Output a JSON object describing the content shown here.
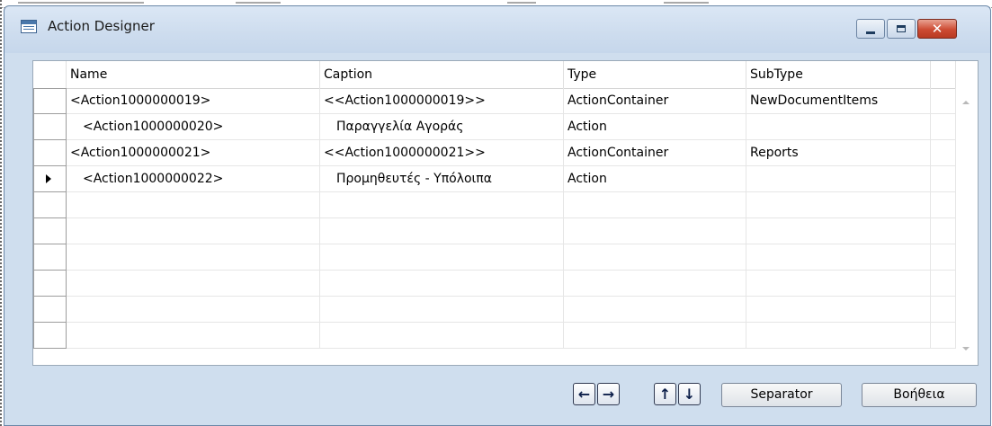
{
  "window": {
    "title": "Action Designer"
  },
  "columns": [
    "Name",
    "Caption",
    "Type",
    "SubType"
  ],
  "rows": [
    {
      "name": "<Action1000000019>",
      "caption": "<<Action1000000019>>",
      "type": "ActionContainer",
      "subtype": "NewDocumentItems",
      "indent": false,
      "current": false
    },
    {
      "name": "<Action1000000020>",
      "caption": "Παραγγελία Αγοράς",
      "type": "Action",
      "subtype": "",
      "indent": true,
      "current": false
    },
    {
      "name": "<Action1000000021>",
      "caption": "<<Action1000000021>>",
      "type": "ActionContainer",
      "subtype": "Reports",
      "indent": false,
      "current": false
    },
    {
      "name": "<Action1000000022>",
      "caption": "Προμηθευτές - Υπόλοιπα",
      "type": "Action",
      "subtype": "",
      "indent": true,
      "current": true
    },
    {
      "name": "",
      "caption": "",
      "type": "",
      "subtype": "",
      "indent": false,
      "current": false
    },
    {
      "name": "",
      "caption": "",
      "type": "",
      "subtype": "",
      "indent": false,
      "current": false
    },
    {
      "name": "",
      "caption": "",
      "type": "",
      "subtype": "",
      "indent": false,
      "current": false
    },
    {
      "name": "",
      "caption": "",
      "type": "",
      "subtype": "",
      "indent": false,
      "current": false
    },
    {
      "name": "",
      "caption": "",
      "type": "",
      "subtype": "",
      "indent": false,
      "current": false
    },
    {
      "name": "",
      "caption": "",
      "type": "",
      "subtype": "",
      "indent": false,
      "current": false
    }
  ],
  "toolbar": {
    "left_arrow": "←",
    "right_arrow": "→",
    "up_arrow": "↑",
    "down_arrow": "↓",
    "separator_label": "Separator",
    "help_label": "Βοήθεια"
  },
  "window_controls": {
    "close_glyph": "✕"
  },
  "colors": {
    "window_bg": "#cfdeee",
    "close_button": "#cd4b33"
  }
}
